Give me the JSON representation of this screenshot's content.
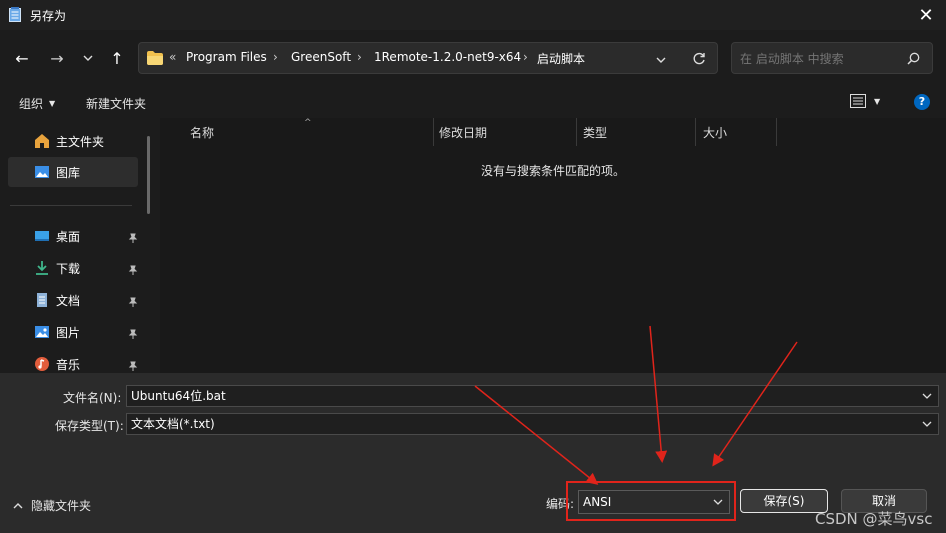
{
  "window": {
    "title": "另存为"
  },
  "address": {
    "crumbs": [
      "Program Files",
      "GreenSoft",
      "1Remote-1.2.0-net9-x64",
      "启动脚本"
    ],
    "overflow": "«"
  },
  "search": {
    "placeholder": "在 启动脚本 中搜索"
  },
  "toolbar": {
    "organize": "组织",
    "new_folder": "新建文件夹"
  },
  "sidebar": {
    "items": [
      {
        "label": "主文件夹"
      },
      {
        "label": "图库"
      },
      {
        "label": "桌面"
      },
      {
        "label": "下载"
      },
      {
        "label": "文档"
      },
      {
        "label": "图片"
      },
      {
        "label": "音乐"
      }
    ]
  },
  "list": {
    "columns": [
      "名称",
      "修改日期",
      "类型",
      "大小"
    ],
    "empty_message": "没有与搜索条件匹配的项。"
  },
  "form": {
    "filename_label": "文件名(N):",
    "filename_value": "Ubuntu64位.bat",
    "filetype_label": "保存类型(T):",
    "filetype_value": "文本文档(*.txt)",
    "encoding_label": "编码:",
    "encoding_value": "ANSI",
    "hide_folders": "隐藏文件夹",
    "save": "保存(S)",
    "cancel": "取消"
  },
  "watermark": "CSDN @菜鸟vsc",
  "colors": {
    "accent": "#0067c0",
    "annotation": "#e0241b"
  }
}
